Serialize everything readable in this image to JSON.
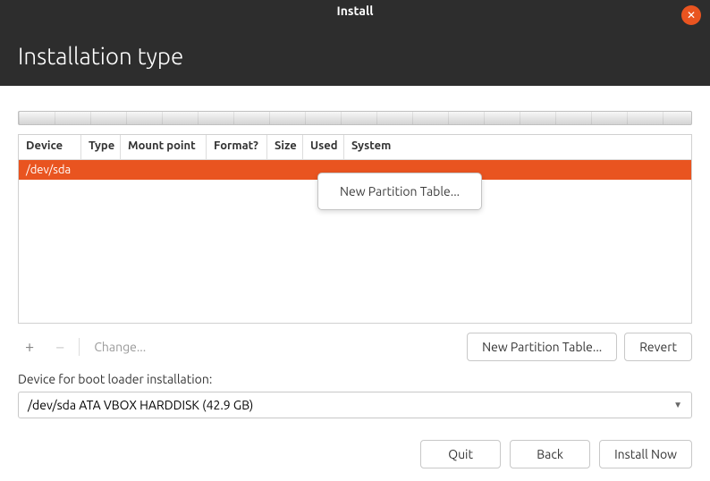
{
  "window": {
    "title": "Install"
  },
  "page": {
    "heading": "Installation type"
  },
  "table": {
    "headers": {
      "device": "Device",
      "type": "Type",
      "mount": "Mount point",
      "format": "Format?",
      "size": "Size",
      "used": "Used",
      "system": "System"
    },
    "rows": [
      {
        "device": "/dev/sda"
      }
    ]
  },
  "contextMenu": {
    "newPartitionTable": "New Partition Table..."
  },
  "toolbar": {
    "plus": "+",
    "minus": "−",
    "change": "Change...",
    "newPartitionTable": "New Partition Table...",
    "revert": "Revert"
  },
  "bootloader": {
    "label": "Device for boot loader installation:",
    "value": "/dev/sda   ATA VBOX HARDDISK (42.9 GB)"
  },
  "footer": {
    "quit": "Quit",
    "back": "Back",
    "installNow": "Install Now"
  }
}
